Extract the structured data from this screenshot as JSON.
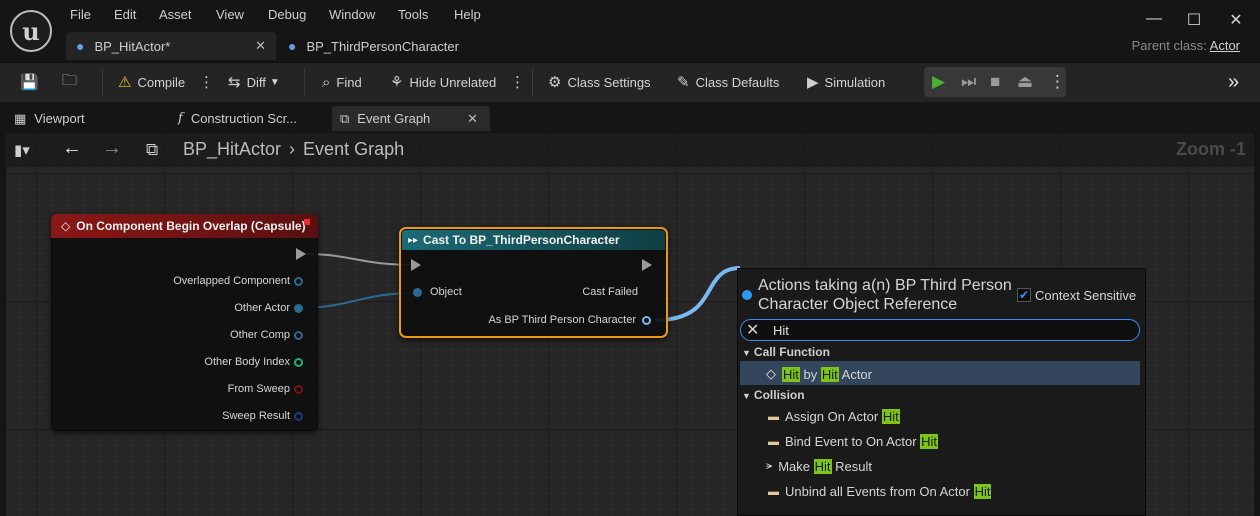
{
  "menu": [
    "File",
    "Edit",
    "Asset",
    "View",
    "Debug",
    "Window",
    "Tools",
    "Help"
  ],
  "tabs": [
    {
      "label": "BP_HitActor*"
    },
    {
      "label": "BP_ThirdPersonCharacter"
    }
  ],
  "parent_class": {
    "label": "Parent class:",
    "value": "Actor"
  },
  "toolbar": {
    "compile": "Compile",
    "diff": "Diff",
    "find": "Find",
    "hide_unrelated": "Hide Unrelated",
    "class_settings": "Class Settings",
    "class_defaults": "Class Defaults",
    "simulation": "Simulation"
  },
  "doc_tabs": [
    "Viewport",
    "Construction Scr...",
    "Event Graph"
  ],
  "breadcrumb": {
    "root": "BP_HitActor",
    "current": "Event Graph"
  },
  "zoom": "Zoom -1",
  "node_overlap": {
    "title": "On Component Begin Overlap (Capsule)",
    "pins": [
      "Overlapped Component",
      "Other Actor",
      "Other Comp",
      "Other Body Index",
      "From Sweep",
      "Sweep Result"
    ]
  },
  "node_cast": {
    "title": "Cast To BP_ThirdPersonCharacter",
    "object": "Object",
    "cast_failed": "Cast Failed",
    "as_output": "As BP Third Person Character"
  },
  "popup": {
    "title": "Actions taking a(n) BP Third Person Character Object Reference",
    "context_sensitive": "Context Sensitive",
    "search": "Hit",
    "cat_call_function": "Call Function",
    "cat_collision": "Collision",
    "hit_by_hit_actor": {
      "a": "Hit",
      "b": " by ",
      "c": "Hit",
      "d": " Actor"
    },
    "assign": {
      "a": "Assign On Actor ",
      "b": "Hit"
    },
    "bind": {
      "a": "Bind Event to On Actor ",
      "b": "Hit"
    },
    "make": {
      "a": "Make ",
      "b": "Hit",
      "c": " Result"
    },
    "unbind": {
      "a": "Unbind all Events from On Actor ",
      "b": "Hit"
    }
  },
  "colors": {
    "accent": "#3a8df0",
    "event_node": "#8a1818",
    "cast_node": "#1b6a74",
    "highlight": "#7fc31a",
    "selected": "#e89a17"
  }
}
